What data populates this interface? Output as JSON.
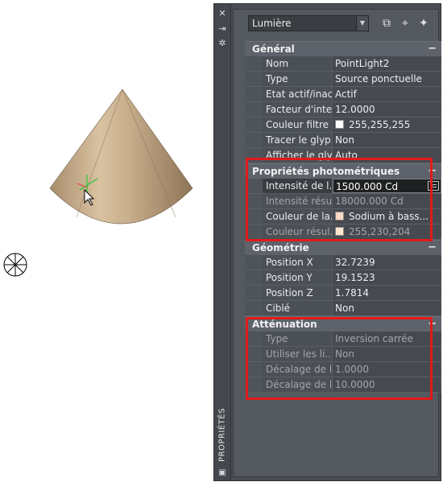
{
  "palette": {
    "title": "PROPRIÉTÉS",
    "selector": {
      "value": "Lumière"
    },
    "sections": [
      {
        "title": "Général",
        "toggle": "−",
        "rows": [
          {
            "name": "Nom",
            "value": "PointLight2"
          },
          {
            "name": "Type",
            "value": "Source ponctuelle"
          },
          {
            "name": "Etat actif/inac...",
            "value": "Actif"
          },
          {
            "name": "Facteur d'inte...",
            "value": "12.0000"
          },
          {
            "name": "Couleur filtre",
            "value": "255,255,255",
            "swatch": "#ffffff"
          },
          {
            "name": "Tracer le glyp...",
            "value": "Non"
          },
          {
            "name": "Afficher le gly...",
            "value": "Auto"
          }
        ]
      },
      {
        "title": "Propriétés photométriques",
        "toggle": "−",
        "rows": [
          {
            "name": "Intensité de l...",
            "value": "1500.000 Cd",
            "active": true
          },
          {
            "name": "Intensité résu...",
            "value": "18000.000 Cd",
            "disabled": true
          },
          {
            "name": "Couleur de la...",
            "value": "Sodium à bass...",
            "swatch": "#ffd9c4"
          },
          {
            "name": "Couleur résul...",
            "value": "255,230,204",
            "swatch": "#ffe6cc",
            "disabled": true
          }
        ]
      },
      {
        "title": "Géométrie",
        "toggle": "−",
        "rows": [
          {
            "name": "Position X",
            "value": "32.7239"
          },
          {
            "name": "Position Y",
            "value": "19.1523"
          },
          {
            "name": "Position Z",
            "value": "1.7814"
          },
          {
            "name": "Ciblé",
            "value": "Non"
          }
        ]
      },
      {
        "title": "Atténuation",
        "toggle": "−",
        "rows": [
          {
            "name": "Type",
            "value": "Inversion carrée",
            "disabled": true
          },
          {
            "name": "Utiliser les li...",
            "value": "Non",
            "disabled": true
          },
          {
            "name": "Décalage de l...",
            "value": "1.0000",
            "disabled": true
          },
          {
            "name": "Décalage de l...",
            "value": "10.0000",
            "disabled": true
          }
        ]
      }
    ]
  },
  "colors": {
    "highlight": "#e21a1a",
    "cone_light": "#dcc3a0",
    "cone_dark": "#a08564"
  }
}
